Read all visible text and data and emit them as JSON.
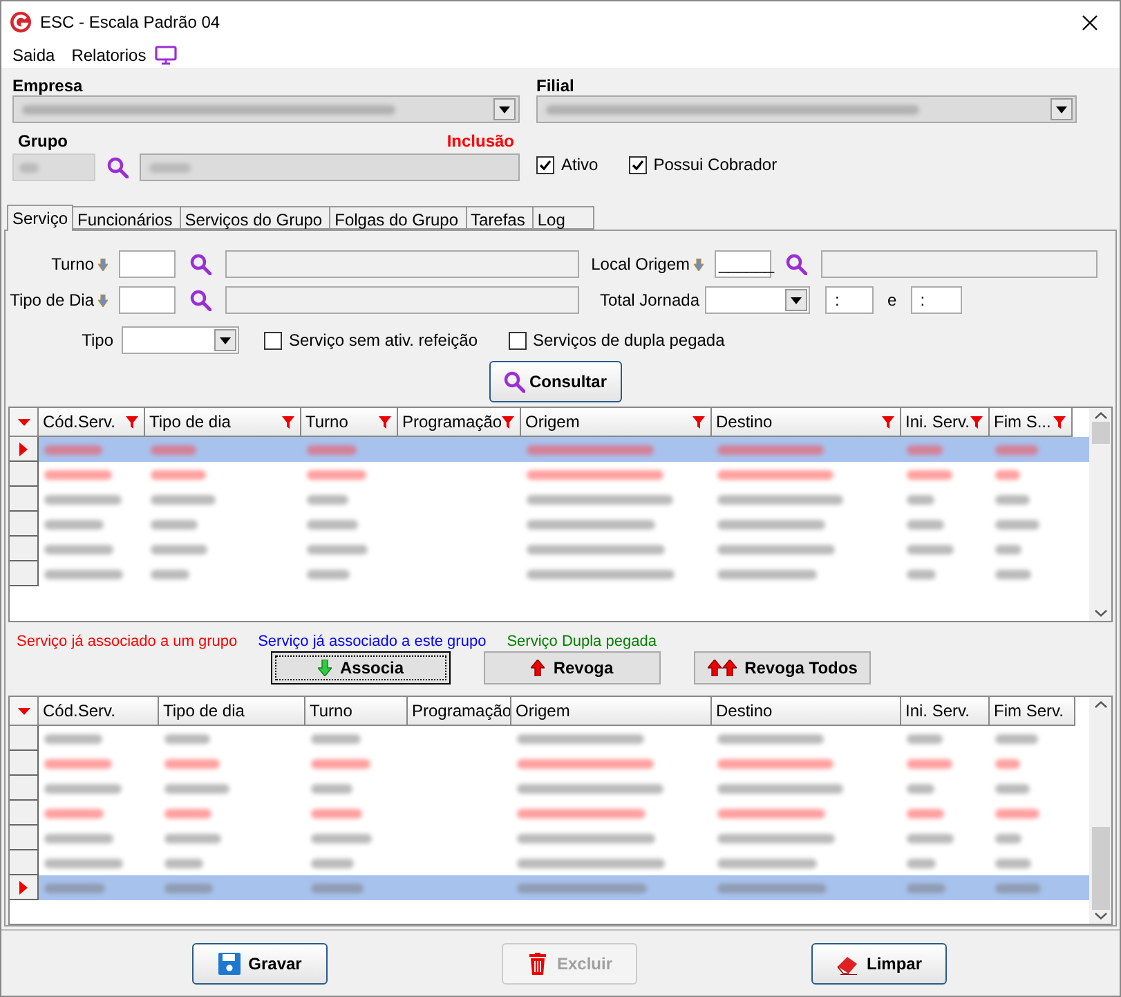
{
  "window": {
    "title": "ESC - Escala Padrão 04"
  },
  "menu": [
    "Saida",
    "Relatorios"
  ],
  "header": {
    "empresa_label": "Empresa",
    "filial_label": "Filial",
    "grupo_label": "Grupo",
    "mode": "Inclusão"
  },
  "header_checks": [
    {
      "label": "Ativo",
      "checked": true
    },
    {
      "label": "Possui Cobrador",
      "checked": true
    }
  ],
  "tabs": [
    {
      "label": "Serviço",
      "selected": true
    },
    {
      "label": "Funcionários",
      "selected": false
    },
    {
      "label": "Serviços do Grupo",
      "selected": false
    },
    {
      "label": "Folgas do Grupo",
      "selected": false
    },
    {
      "label": "Tarefas",
      "selected": false
    },
    {
      "label": "Log",
      "selected": false
    }
  ],
  "filters": {
    "turno": "Turno",
    "tipo_dia": "Tipo de Dia",
    "local_origem": "Local Origem",
    "local_origem_value": "______",
    "total_jornada": "Total Jornada",
    "time_from": ":",
    "between": "e",
    "time_to": ":",
    "tipo": "Tipo"
  },
  "filter_checks": [
    {
      "label": "Serviço sem ativ. refeição",
      "checked": false
    },
    {
      "label": "Serviços de dupla pegada",
      "checked": false
    }
  ],
  "consult_button": "Consultar",
  "grid_top": {
    "columns": [
      {
        "label": "Cód.Serv.",
        "filter": true
      },
      {
        "label": "Tipo de dia",
        "filter": true
      },
      {
        "label": "Turno",
        "filter": true
      },
      {
        "label": "Programação",
        "filter": true
      },
      {
        "label": "Origem",
        "filter": true
      },
      {
        "label": "Destino",
        "filter": true
      },
      {
        "label": "Ini. Serv.",
        "filter": true
      },
      {
        "label": "Fim S...",
        "filter": true
      }
    ],
    "rows": [
      {
        "selected": true,
        "kind": "associated"
      },
      {
        "selected": false,
        "kind": "associated"
      },
      {
        "selected": false,
        "kind": "free"
      },
      {
        "selected": false,
        "kind": "free"
      },
      {
        "selected": false,
        "kind": "free"
      },
      {
        "selected": false,
        "kind": "free"
      }
    ]
  },
  "legend": [
    {
      "text": "Serviço já associado a um grupo",
      "color": "#ff0000"
    },
    {
      "text": "Serviço já associado a este grupo",
      "color": "#0000ff"
    },
    {
      "text": "Serviço Dupla pegada",
      "color": "#008000"
    }
  ],
  "move_buttons": [
    {
      "label": "Associa",
      "kind": "down"
    },
    {
      "label": "Revoga",
      "kind": "up"
    },
    {
      "label": "Revoga Todos",
      "kind": "up_all"
    }
  ],
  "grid_bottom": {
    "columns": [
      {
        "label": "Cód.Serv."
      },
      {
        "label": "Tipo de dia"
      },
      {
        "label": "Turno"
      },
      {
        "label": "Programação"
      },
      {
        "label": "Origem"
      },
      {
        "label": "Destino"
      },
      {
        "label": "Ini. Serv."
      },
      {
        "label": "Fim Serv."
      }
    ],
    "rows": [
      {
        "selected": false,
        "kind": "free"
      },
      {
        "selected": false,
        "kind": "associated"
      },
      {
        "selected": false,
        "kind": "free"
      },
      {
        "selected": false,
        "kind": "associated"
      },
      {
        "selected": false,
        "kind": "free"
      },
      {
        "selected": false,
        "kind": "free"
      },
      {
        "selected": true,
        "kind": "free"
      }
    ]
  },
  "footer_buttons": [
    {
      "label": "Gravar",
      "kind": "save",
      "disabled": false
    },
    {
      "label": "Excluir",
      "kind": "delete",
      "disabled": true
    },
    {
      "label": "Limpar",
      "kind": "clear",
      "disabled": false
    }
  ]
}
